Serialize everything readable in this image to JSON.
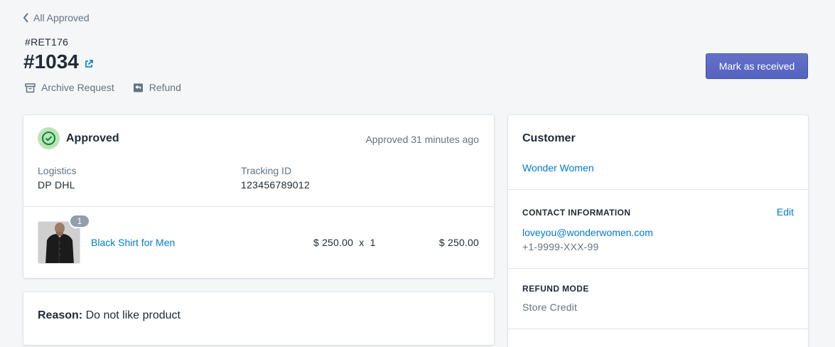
{
  "header": {
    "back_label": "All Approved",
    "return_id": "#RET176",
    "order_number": "#1034",
    "actions": {
      "archive_label": "Archive Request",
      "refund_label": "Refund"
    },
    "primary_button_label": "Mark as received"
  },
  "status_card": {
    "status": "Approved",
    "status_time": "Approved 31 minutes ago",
    "logistics_label": "Logistics",
    "logistics_value": "DP DHL",
    "tracking_label": "Tracking ID",
    "tracking_value": "123456789012",
    "item": {
      "quantity_badge": "1",
      "name": "Black Shirt for Men",
      "price_line": "$ 250.00  x  1",
      "total": "$ 250.00"
    }
  },
  "reason_card": {
    "label": "Reason:",
    "value": "Do not like product"
  },
  "customer_card": {
    "title": "Customer",
    "customer_name": "Wonder Women",
    "contact_heading": "CONTACT INFORMATION",
    "edit_label": "Edit",
    "email": "loveyou@wonderwomen.com",
    "phone": "+1-9999-XXX-99",
    "refund_heading": "REFUND MODE",
    "refund_value": "Store Credit"
  },
  "colors": {
    "primary": "#5c6ac4",
    "link": "#007ace",
    "success_bg": "#bbe5b3",
    "success_icon": "#108043",
    "subdued": "#637381"
  }
}
